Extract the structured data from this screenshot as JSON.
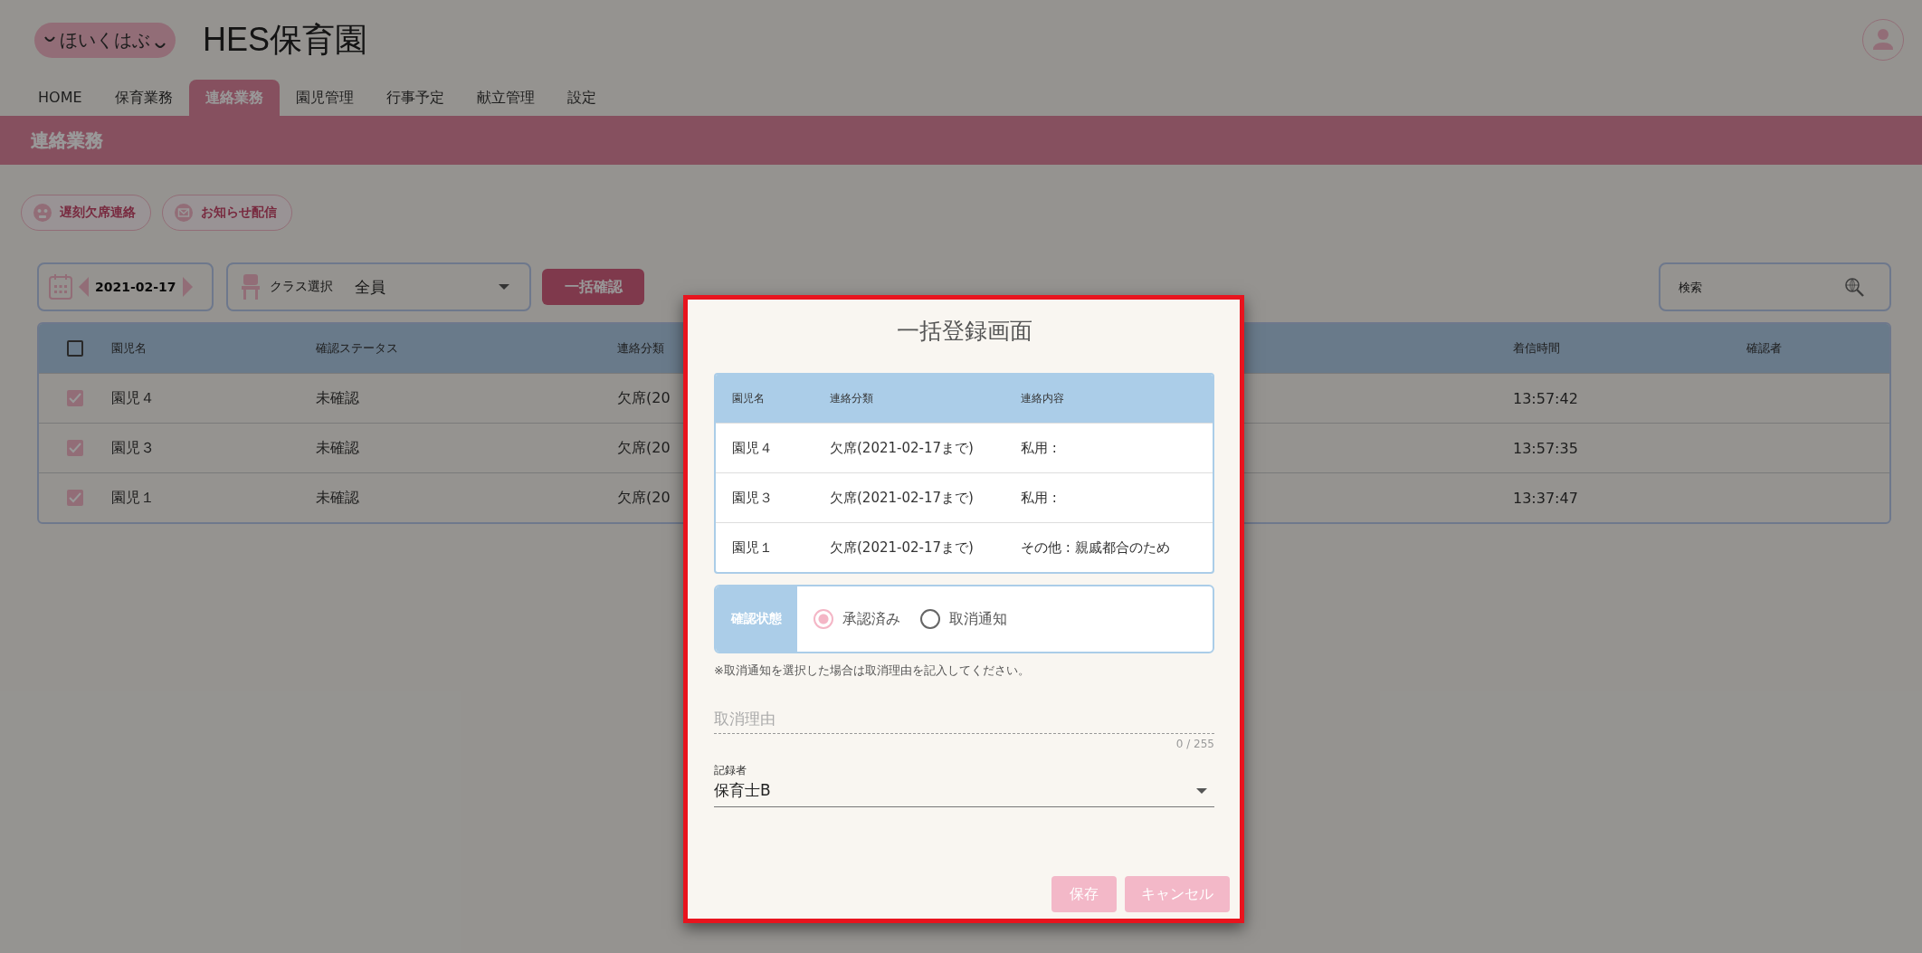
{
  "app": {
    "logo": "ほいくはぶ",
    "title": "HES保育園"
  },
  "nav_tabs": [
    {
      "label": "HOME",
      "selected": false
    },
    {
      "label": "保育業務",
      "selected": false
    },
    {
      "label": "連絡業務",
      "selected": true
    },
    {
      "label": "園児管理",
      "selected": false
    },
    {
      "label": "行事予定",
      "selected": false
    },
    {
      "label": "献立管理",
      "selected": false
    },
    {
      "label": "設定",
      "selected": false
    }
  ],
  "section_title": "連絡業務",
  "action_buttons": [
    {
      "label": "遅刻欠席連絡",
      "kind": "absence"
    },
    {
      "label": "お知らせ配信",
      "kind": "mail"
    }
  ],
  "toolbar": {
    "date": "2021-02-17",
    "class_label": "クラス選択",
    "class_value": "全員",
    "bulk_button": "一括確認",
    "search": {
      "placeholder": "検索"
    }
  },
  "table": {
    "header_checked": false,
    "columns": [
      "園児名",
      "確認ステータス",
      "連絡分類",
      "着信時間",
      "確認者"
    ],
    "rows": [
      {
        "checked": true,
        "name": "園児４",
        "status": "未確認",
        "category": "欠席(20",
        "time": "13:57:42"
      },
      {
        "checked": true,
        "name": "園児３",
        "status": "未確認",
        "category": "欠席(20",
        "time": "13:57:35"
      },
      {
        "checked": true,
        "name": "園児１",
        "status": "未確認",
        "category": "欠席(20",
        "time": "13:37:47"
      }
    ]
  },
  "modal": {
    "title": "一括登録画面",
    "table": {
      "columns": [
        "園児名",
        "連絡分類",
        "連絡内容"
      ],
      "rows": [
        [
          "園児４",
          "欠席(2021-02-17まで)",
          "私用 :"
        ],
        [
          "園児３",
          "欠席(2021-02-17まで)",
          "私用 :"
        ],
        [
          "園児１",
          "欠席(2021-02-17まで)",
          "その他 : 親戚都合のため"
        ]
      ]
    },
    "status": {
      "label": "確認状態",
      "options": [
        {
          "label": "承認済み",
          "selected": true
        },
        {
          "label": "取消通知",
          "selected": false
        }
      ]
    },
    "note": "※取消通知を選択した場合は取消理由を記入してください。",
    "reason": {
      "placeholder": "取消理由",
      "counter": "0 / 255"
    },
    "recorder": {
      "label": "記録者",
      "value": "保育士B"
    },
    "buttons": [
      {
        "label": "保存",
        "disabled": true
      },
      {
        "label": "キャンセル",
        "disabled": true
      }
    ]
  }
}
